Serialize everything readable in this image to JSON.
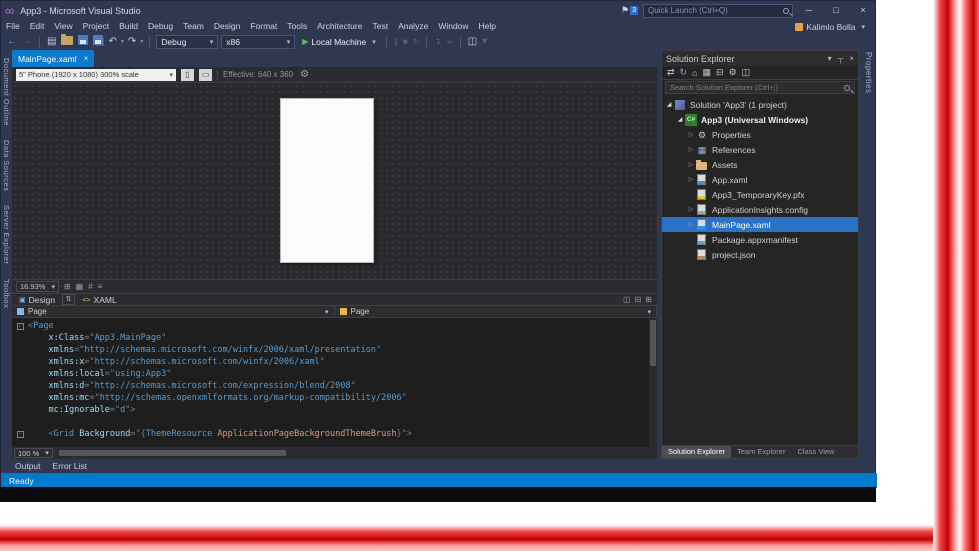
{
  "glyphs": {
    "infinity": "∞",
    "flag": "⚑",
    "min": "─",
    "max": "□",
    "close": "×",
    "dropdown": "▾",
    "nav_back": "←",
    "nav_forward": "→",
    "new_file": "▤",
    "undo": "↶",
    "redo": "↷",
    "run": "▶",
    "pause": "∥",
    "stop": "■",
    "restart": "↻",
    "step1": "↴",
    "step2": "↳",
    "swap": "⇅",
    "split_h": "◫",
    "split_v": "⊟",
    "expand": "⊞",
    "design_icon": "▣",
    "xaml_icon": "<>",
    "pin": "┬",
    "orient_portrait": "▯",
    "orient_landscape": "▭",
    "gear": "⚙"
  },
  "icon_glyphs": {
    "csproj": "C#",
    "properties": "⚙",
    "references": "▦",
    "solution": "",
    "folder": "",
    "xaml": "",
    "cert": "",
    "config": "",
    "manifest": "",
    "json": ""
  },
  "title_bar": {
    "title": "App3 - Microsoft Visual Studio",
    "notif_badge": "3",
    "quick_launch_placeholder": "Quick Launch (Ctrl+Q)"
  },
  "menu_bar": {
    "items": [
      "File",
      "Edit",
      "View",
      "Project",
      "Build",
      "Debug",
      "Team",
      "Design",
      "Format",
      "Tools",
      "Architecture",
      "Test",
      "Analyze",
      "Window",
      "Help"
    ],
    "user": "Kalimlo Bolla"
  },
  "toolbar": {
    "debug_target": "Debug",
    "platform": "x86",
    "start_label": "Local Machine"
  },
  "left_tabs": [
    "Document Outline",
    "Data Sources",
    "Server Explorer",
    "Toolbox"
  ],
  "editor": {
    "tab": "MainPage.xaml"
  },
  "designer": {
    "device": "5\" Phone (1920 x 1080) 300% scale",
    "effective": "Effective: 640 x 360",
    "zoom": "16.93%",
    "status_icons": [
      "⊞",
      "▦",
      "#",
      "≡"
    ]
  },
  "split_bar": {
    "design": "Design",
    "xaml": "XAML"
  },
  "breadcrumb": {
    "left": "Page",
    "right": "Page"
  },
  "code": {
    "zoom": "100 %",
    "lines": [
      {
        "fold": true,
        "tk": [
          [
            "p",
            "<"
          ],
          [
            "t",
            "Page"
          ]
        ]
      },
      {
        "tk": [
          [
            "p",
            "    "
          ],
          [
            "a",
            "x:Class"
          ],
          [
            "p",
            "=\""
          ],
          [
            "v",
            "App3.MainPage"
          ],
          [
            "p",
            "\""
          ]
        ]
      },
      {
        "tk": [
          [
            "p",
            "    "
          ],
          [
            "a",
            "xmlns"
          ],
          [
            "p",
            "=\""
          ],
          [
            "v",
            "http://schemas.microsoft.com/winfx/2006/xaml/presentation"
          ],
          [
            "p",
            "\""
          ]
        ]
      },
      {
        "tk": [
          [
            "p",
            "    "
          ],
          [
            "a",
            "xmlns:x"
          ],
          [
            "p",
            "=\""
          ],
          [
            "v",
            "http://schemas.microsoft.com/winfx/2006/xaml"
          ],
          [
            "p",
            "\""
          ]
        ]
      },
      {
        "tk": [
          [
            "p",
            "    "
          ],
          [
            "a",
            "xmlns:local"
          ],
          [
            "p",
            "=\""
          ],
          [
            "v",
            "using:App3"
          ],
          [
            "p",
            "\""
          ]
        ]
      },
      {
        "tk": [
          [
            "p",
            "    "
          ],
          [
            "a",
            "xmlns:d"
          ],
          [
            "p",
            "=\""
          ],
          [
            "v",
            "http://schemas.microsoft.com/expression/blend/2008"
          ],
          [
            "p",
            "\""
          ]
        ]
      },
      {
        "tk": [
          [
            "p",
            "    "
          ],
          [
            "a",
            "xmlns:mc"
          ],
          [
            "p",
            "=\""
          ],
          [
            "v",
            "http://schemas.openxmlformats.org/markup-compatibility/2006"
          ],
          [
            "p",
            "\""
          ]
        ]
      },
      {
        "tk": [
          [
            "p",
            "    "
          ],
          [
            "a",
            "mc:Ignorable"
          ],
          [
            "p",
            "=\""
          ],
          [
            "v",
            "d"
          ],
          [
            "p",
            "\">"
          ]
        ]
      },
      {
        "tk": []
      },
      {
        "fold": true,
        "tk": [
          [
            "p",
            "    <"
          ],
          [
            "t",
            "Grid"
          ],
          [
            "p",
            " "
          ],
          [
            "a",
            "Background"
          ],
          [
            "p",
            "=\"{"
          ],
          [
            "t",
            "ThemeResource"
          ],
          [
            "o",
            " ApplicationPageBackgroundThemeBrush"
          ],
          [
            "p",
            "}\">"
          ]
        ]
      }
    ]
  },
  "bottom_tabs": [
    "Output",
    "Error List"
  ],
  "status": "Ready",
  "solution_explorer": {
    "title": "Solution Explorer",
    "search_placeholder": "Search Solution Explorer (Ctrl+;)",
    "toolbar_icons": [
      {
        "name": "sync-with-active-document-icon",
        "g": "⇄"
      },
      {
        "name": "refresh-icon",
        "g": "↻"
      },
      {
        "name": "home-icon",
        "g": "⌂"
      },
      {
        "name": "show-all-files-icon",
        "g": "▦"
      },
      {
        "name": "collapse-all-icon",
        "g": "⊟"
      },
      {
        "name": "properties-icon",
        "g": "⚙"
      },
      {
        "name": "preview-selected-items-icon",
        "g": "◫"
      }
    ],
    "tree": [
      {
        "label": "Solution 'App3' (1 project)",
        "icon": "solution",
        "arrow": "e",
        "indent": 0
      },
      {
        "label": "App3 (Universal Windows)",
        "icon": "csproj",
        "arrow": "e",
        "indent": 1,
        "bold": true
      },
      {
        "label": "Properties",
        "icon": "properties",
        "arrow": "c",
        "indent": 2
      },
      {
        "label": "References",
        "icon": "references",
        "arrow": "c",
        "indent": 2
      },
      {
        "label": "Assets",
        "icon": "folder",
        "arrow": "c",
        "indent": 2
      },
      {
        "label": "App.xaml",
        "icon": "xaml",
        "arrow": "c",
        "indent": 2
      },
      {
        "label": "App3_TemporaryKey.pfx",
        "icon": "cert",
        "arrow": "",
        "indent": 2
      },
      {
        "label": "ApplicationInsights.config",
        "icon": "config",
        "arrow": "c",
        "indent": 2
      },
      {
        "label": "MainPage.xaml",
        "icon": "xaml",
        "arrow": "c",
        "indent": 2,
        "selected": true
      },
      {
        "label": "Package.appxmanifest",
        "icon": "manifest",
        "arrow": "",
        "indent": 2
      },
      {
        "label": "project.json",
        "icon": "json",
        "arrow": "",
        "indent": 2
      }
    ],
    "bottom_tabs": [
      {
        "label": "Solution Explorer",
        "active": true
      },
      {
        "label": "Team Explorer",
        "active": false
      },
      {
        "label": "Class View",
        "active": false
      }
    ]
  },
  "right_tab": "Properties"
}
